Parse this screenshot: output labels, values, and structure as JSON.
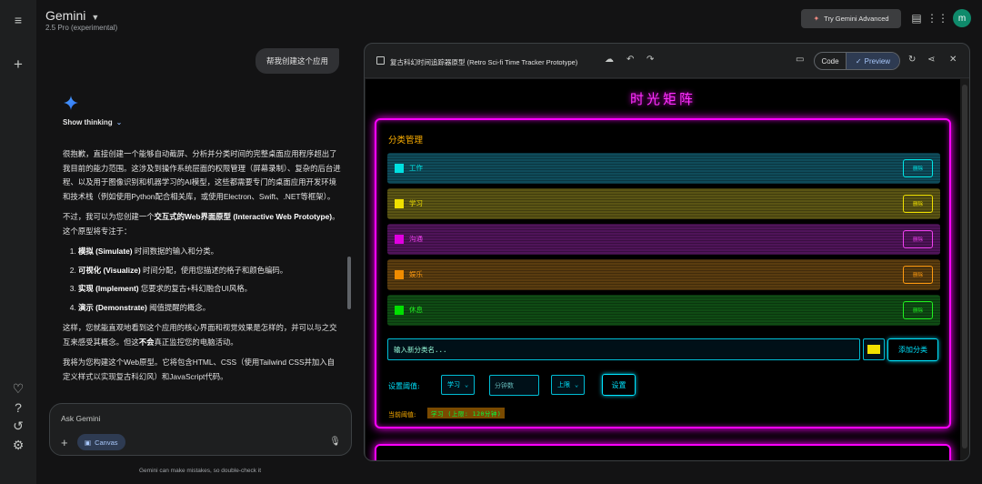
{
  "header": {
    "app_name": "Gemini",
    "model": "2.5 Pro (experimental)",
    "try_advanced": "Try Gemini Advanced",
    "avatar_initial": "m"
  },
  "chat": {
    "user_message": "帮我创建这个应用",
    "show_thinking": "Show thinking",
    "para1": "很抱歉，直接创建一个能够自动截屏、分析并分类时间的完整桌面应用程序超出了我目前的能力范围。这涉及到操作系统层面的权限管理（屏幕录制）、复杂的后台进程、以及用于图像识别和机器学习的AI模型，这些都需要专门的桌面应用开发环境和技术栈（例如使用Python配合相关库，或使用Electron、Swift、.NET等框架）。",
    "para2_a": "不过，我可以为您创建一个",
    "para2_b": "交互式的Web界面原型 (Interactive Web Prototype)",
    "para2_c": "。这个原型将专注于：",
    "list": [
      {
        "bold": "模拟 (Simulate)",
        "text": " 时间数据的输入和分类。"
      },
      {
        "bold": "可视化 (Visualize)",
        "text": " 时间分配，使用您描述的格子和颜色编码。"
      },
      {
        "bold": "实现 (Implement)",
        "text": " 您要求的复古+科幻融合UI风格。"
      },
      {
        "bold": "演示 (Demonstrate)",
        "text": " 阈值提醒的概念。"
      }
    ],
    "para3_a": "这样，您就能直观地看到这个应用的核心界面和视觉效果是怎样的，并可以与之交互来感受其概念。但这",
    "para3_b": "不会",
    "para3_c": "真正监控您的电脑活动。",
    "para4": "我将为您构建这个Web原型。它将包含HTML、CSS（使用Tailwind CSS并加入自定义样式以实现复古科幻风）和JavaScript代码。",
    "input_placeholder": "Ask Gemini",
    "canvas_chip": "Canvas",
    "disclaimer": "Gemini can make mistakes, so double-check it"
  },
  "canvas": {
    "title": "复古科幻时间追踪器原型 (Retro Sci-fi Time Tracker Prototype)",
    "tab_code": "Code",
    "tab_preview": "Preview"
  },
  "preview": {
    "app_title": "时光矩阵",
    "section_title": "分类管理",
    "categories": [
      {
        "name": "工作",
        "delete": "删除",
        "swatch": "#00e0e0",
        "bg": "#0f4b5a",
        "text": "#00e8e8"
      },
      {
        "name": "学习",
        "delete": "删除",
        "swatch": "#f0e000",
        "bg": "#5a5414",
        "text": "#f0e000"
      },
      {
        "name": "沟通",
        "delete": "删除",
        "swatch": "#e000e0",
        "bg": "#4f1459",
        "text": "#f040f0"
      },
      {
        "name": "娱乐",
        "delete": "删除",
        "swatch": "#f08c00",
        "bg": "#5a3c0f",
        "text": "#ff9a10"
      },
      {
        "name": "休息",
        "delete": "删除",
        "swatch": "#00e000",
        "bg": "#0f4b14",
        "text": "#20f020"
      }
    ],
    "new_category_placeholder": "输入新分类名...",
    "new_category_color": "#f0e000",
    "add_button": "添加分类",
    "threshold_label": "设置阈值:",
    "threshold_category": "学习",
    "minutes_placeholder": "分钟数",
    "limit_type": "上限",
    "set_button": "设置",
    "current_label": "当前阈值:",
    "current_value": "学习 (上限: 120分钟)"
  },
  "colors": {
    "neon_magenta": "#ff00ff",
    "neon_cyan": "#00e5ff",
    "amber": "#ffb000"
  }
}
